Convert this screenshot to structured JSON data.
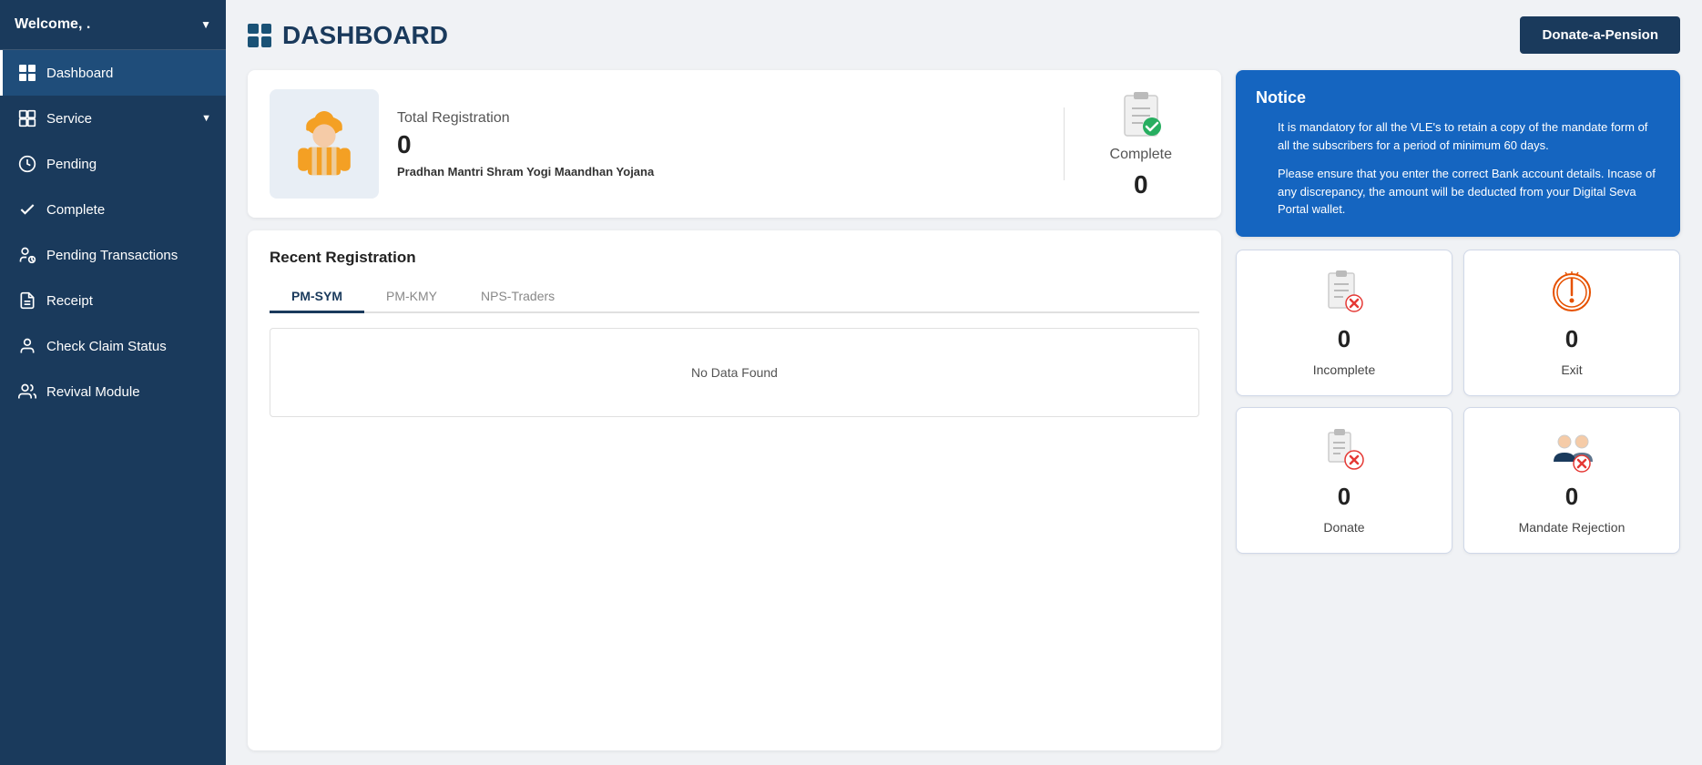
{
  "sidebar": {
    "welcome_label": "Welcome, .",
    "items": [
      {
        "id": "dashboard",
        "label": "Dashboard",
        "active": true,
        "icon": "grid"
      },
      {
        "id": "service",
        "label": "Service",
        "active": false,
        "icon": "grid2",
        "has_chevron": true
      },
      {
        "id": "pending",
        "label": "Pending",
        "active": false,
        "icon": "clock"
      },
      {
        "id": "complete",
        "label": "Complete",
        "active": false,
        "icon": "check"
      },
      {
        "id": "pending-transactions",
        "label": "Pending Transactions",
        "active": false,
        "icon": "user-clock"
      },
      {
        "id": "receipt",
        "label": "Receipt",
        "active": false,
        "icon": "doc"
      },
      {
        "id": "check-claim",
        "label": "Check Claim Status",
        "active": false,
        "icon": "user"
      },
      {
        "id": "revival",
        "label": "Revival Module",
        "active": false,
        "icon": "user2"
      }
    ]
  },
  "header": {
    "title": "DASHBOARD",
    "donate_button": "Donate-a-Pension"
  },
  "stats": {
    "total_registration_label": "Total Registration",
    "total_registration_value": "0",
    "scheme_name": "Pradhan Mantri Shram Yogi Maandhan Yojana",
    "complete_label": "Complete",
    "complete_value": "0"
  },
  "recent_registration": {
    "title": "Recent Registration",
    "tabs": [
      {
        "label": "PM-SYM",
        "active": true
      },
      {
        "label": "PM-KMY",
        "active": false
      },
      {
        "label": "NPS-Traders",
        "active": false
      }
    ],
    "no_data_text": "No Data Found"
  },
  "notice": {
    "title": "Notice",
    "items": [
      "It is mandatory for all the VLE's to retain a copy of the mandate form of all the subscribers for a period of minimum 60 days.",
      "Please ensure that you enter the correct Bank account details. Incase of any discrepancy, the amount will be deducted from your Digital Seva Portal wallet."
    ]
  },
  "stat_boxes": [
    {
      "id": "incomplete",
      "label": "Incomplete",
      "value": "0",
      "icon_type": "incomplete"
    },
    {
      "id": "exit",
      "label": "Exit",
      "value": "0",
      "icon_type": "exit"
    },
    {
      "id": "donate",
      "label": "Donate",
      "value": "0",
      "icon_type": "donate"
    },
    {
      "id": "mandate",
      "label": "Mandate Rejection",
      "value": "0",
      "icon_type": "mandate"
    }
  ]
}
